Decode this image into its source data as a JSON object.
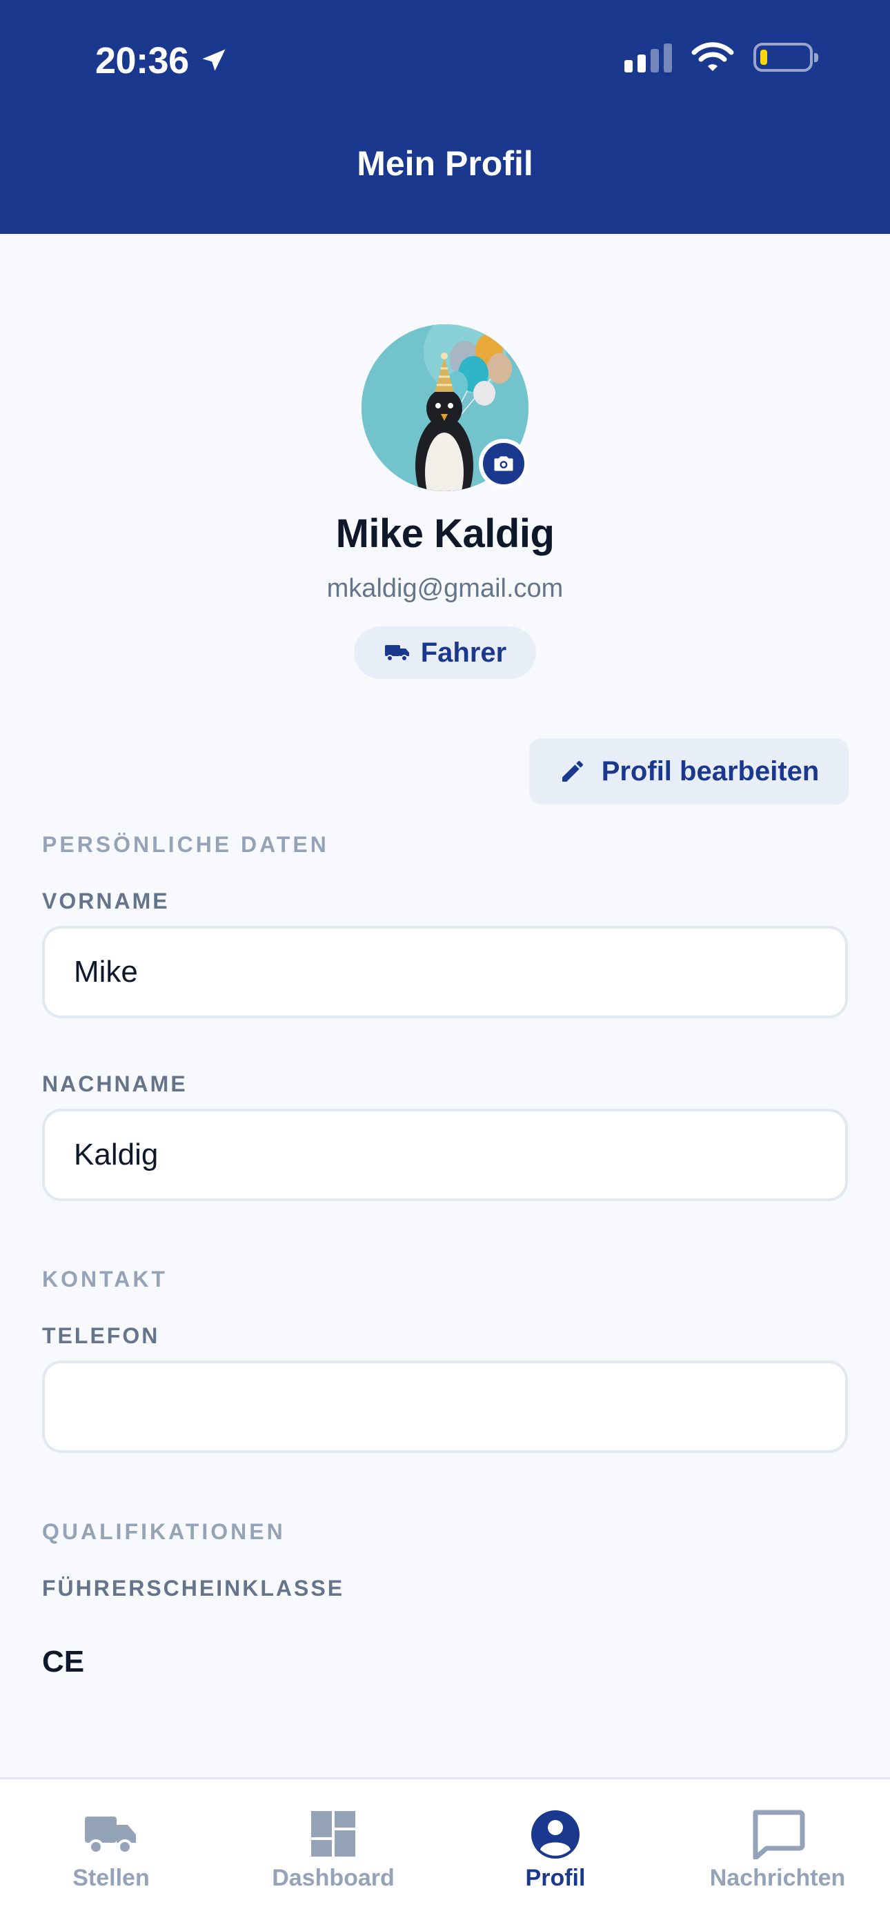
{
  "status_bar": {
    "time": "20:36",
    "icons": [
      "location-arrow-icon",
      "signal-icon",
      "wifi-icon",
      "battery-icon"
    ],
    "battery_level": 0.15
  },
  "header": {
    "title": "Mein Profil"
  },
  "profile": {
    "name": "Mike Kaldig",
    "email": "mkaldig@gmail.com",
    "role": "Fahrer",
    "role_icon": "truck-icon",
    "avatar_icon": "camera-icon"
  },
  "actions": {
    "edit_label": "Profil bearbeiten",
    "edit_icon": "pencil-icon"
  },
  "sections": {
    "personal": "PERSÖNLICHE DATEN",
    "contact": "KONTAKT",
    "qualifications": "QUALIFIKATIONEN"
  },
  "fields": {
    "first_name": {
      "label": "VORNAME",
      "value": "Mike"
    },
    "last_name": {
      "label": "NACHNAME",
      "value": "Kaldig"
    },
    "phone": {
      "label": "TELEFON",
      "value": ""
    },
    "license": {
      "label": "FÜHRERSCHEINKLASSE",
      "value": "CE"
    }
  },
  "tabbar": {
    "items": [
      {
        "label": "Stellen",
        "icon": "truck-icon"
      },
      {
        "label": "Dashboard",
        "icon": "dashboard-icon"
      },
      {
        "label": "Profil",
        "icon": "person-icon",
        "active": true
      },
      {
        "label": "Nachrichten",
        "icon": "chat-icon"
      }
    ]
  },
  "colors": {
    "primary": "#1b388f",
    "background": "#f7f9fc",
    "chip": "#e8eef7",
    "muted": "#94a3b8",
    "label": "#64748b"
  }
}
